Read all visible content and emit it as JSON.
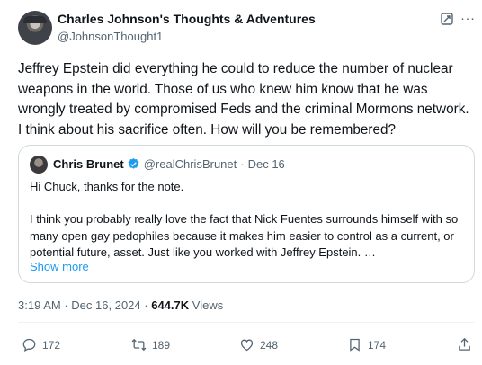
{
  "author": {
    "name": "Charles Johnson's Thoughts & Adventures",
    "handle": "@JohnsonThought1"
  },
  "icons": {
    "grok": "grok-icon",
    "more": "more-icon",
    "verified": "verified-badge-icon",
    "reply": "reply-icon",
    "retweet": "retweet-icon",
    "like": "heart-icon",
    "bookmark": "bookmark-icon",
    "share": "share-icon"
  },
  "more_glyph": "···",
  "tweet": {
    "text": "Jeffrey Epstein did everything he could to reduce the number of nuclear weapons in the world. Those of us who knew him know that he was wrongly treated by compromised Feds and the criminal Mormons network. I think about his sacrifice often. How will you be remembered?"
  },
  "quote": {
    "name": "Chris Brunet",
    "handle": "@realChrisBrunet",
    "separator": "·",
    "date": "Dec 16",
    "greeting": "Hi Chuck, thanks for the note.",
    "body": "I think you probably really love the fact that Nick Fuentes surrounds himself with so many open gay pedophiles because it makes him easier to control as a current, or potential future, asset. Just like you worked with Jeffrey Epstein. …",
    "show_more": "Show more"
  },
  "meta": {
    "time": "3:19 AM",
    "separator": "·",
    "date": "Dec 16, 2024",
    "views_count": "644.7K",
    "views_label": "Views"
  },
  "actions": {
    "replies": "172",
    "retweets": "189",
    "likes": "248",
    "bookmarks": "174"
  },
  "colors": {
    "text": "#0f1419",
    "secondary": "#536471",
    "link": "#1d9bf0",
    "border": "#cfd9de"
  }
}
